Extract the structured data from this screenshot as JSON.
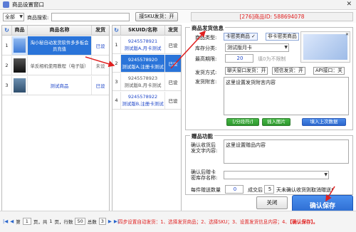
{
  "window": {
    "title": "商品设置窗口",
    "close_glyph": "✕"
  },
  "toolbar": {
    "scope_select": "全部",
    "search_label": "商品搜索:",
    "search_value": "",
    "sku_button": "接SKU发货：开",
    "product_id_banner": "[276]商品ID: 588694078"
  },
  "left_table": {
    "headers": [
      "",
      "商品",
      "商品名称",
      "发货"
    ],
    "rows": [
      {
        "num": "1",
        "name": "淘小秘自动发货软件多多板会员充值",
        "status": "已设",
        "selected": true
      },
      {
        "num": "2",
        "name": "单反相机使用教程（电子版）",
        "status": "未设",
        "selected": false
      },
      {
        "num": "3",
        "name": "测试商品",
        "status": "已设",
        "selected": false
      }
    ]
  },
  "sku_table": {
    "headers": [
      "",
      "SKUID/名称",
      "发货"
    ],
    "rows": [
      {
        "num": "1",
        "id": "9245578921",
        "name": "测试版A,月卡测试",
        "status": "已设",
        "selected": false
      },
      {
        "num": "2",
        "id": "9245578920",
        "name": "测试版A,注册卡测试",
        "status": "已设",
        "selected": true
      },
      {
        "num": "3",
        "id": "9245578923",
        "name": "测试版B,月卡测试",
        "status": "已设",
        "selected": false
      },
      {
        "num": "4",
        "id": "9245578922",
        "name": "测试版B,注册卡测试",
        "status": "已设",
        "selected": false
      }
    ]
  },
  "product_info": {
    "section_title": "商品发货信息",
    "type_label": "商品类型:",
    "type_opt_card": "卡密类商品",
    "type_opt_noncard": "非卡密类商品",
    "stock_label": "库存分类:",
    "stock_value": "测试版月卡",
    "cycle_label": "最高期限:",
    "cycle_value": "20",
    "cycle_hint": "填0为不限制",
    "method_label": "发货方式:",
    "method_chat": "聊天窗口发货：开",
    "method_sms": "短信发货：开",
    "method_api": "API接口：关",
    "note_label": "发货附言:",
    "note_value": "这里设置发货附言内容",
    "btn_separator": "[/分段符/]",
    "btn_insert_image": "插入图片",
    "btn_import_last": "填入上次数据"
  },
  "gift": {
    "section_title": "赠品功能",
    "gift_text_label": "确认收货后\n发文字内容:",
    "gift_text_value": "这里设置赠品内容",
    "gift_stock_label": "确认后赠卡\n密库存名称:",
    "gift_stock_value": "",
    "gift_qty_label": "每件赠送数量",
    "gift_qty_value": "0",
    "gift_days_label": "成交后",
    "gift_days_value": "5",
    "gift_days_suffix": "天未确认收货则取消赠送!"
  },
  "actions": {
    "close_label": "关闭",
    "save_label": "确认保存"
  },
  "status": {
    "pager_first": "|◀",
    "pager_prev": "◀",
    "page_label_a": "第",
    "page_value": "1",
    "page_label_b": "页，共",
    "page_total": "1",
    "page_label_c": "页，行数",
    "row_count": "50",
    "page_total_label": "总数",
    "page_count": "3",
    "pager_next": "▶",
    "pager_last": "▶|",
    "instruction_prefix": "四步设置自动发货：1、选择发货商品；2、选择SKU；3、设置发货信息内容；4、",
    "instruction_highlight": "【确认保存】。"
  },
  "colors": {
    "selection_blue": "#2a74d9",
    "arrow_red": "#e02020",
    "banner_red": "#e02020"
  }
}
